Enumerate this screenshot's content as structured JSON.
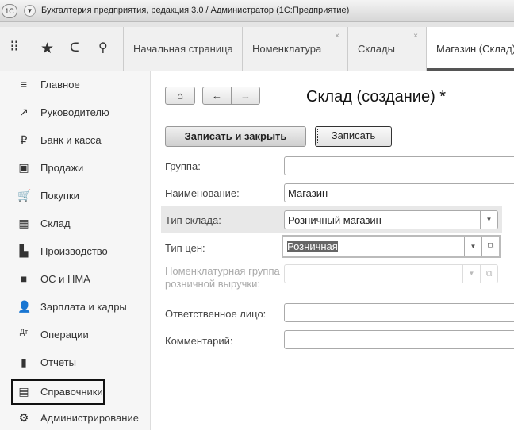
{
  "window": {
    "title": "Бухгалтерия предприятия, редакция 3.0 / Администратор  (1С:Предприятие)",
    "logo": "1С"
  },
  "toolbar_icons": [
    "apps-grid-icon",
    "star-icon",
    "history-icon",
    "search-icon"
  ],
  "tabs": [
    {
      "label": "Начальная страница"
    },
    {
      "label": "Номенклатура"
    },
    {
      "label": "Склады"
    },
    {
      "label": "Магазин (Склад)"
    }
  ],
  "sidebar": {
    "items": [
      {
        "label": "Главное",
        "icon": "≡"
      },
      {
        "label": "Руководителю",
        "icon": "↗"
      },
      {
        "label": "Банк и касса",
        "icon": "₽"
      },
      {
        "label": "Продажи",
        "icon": "▣"
      },
      {
        "label": "Покупки",
        "icon": "🛒"
      },
      {
        "label": "Склад",
        "icon": "▦"
      },
      {
        "label": "Производство",
        "icon": "▙"
      },
      {
        "label": "ОС и НМА",
        "icon": "■"
      },
      {
        "label": "Зарплата и кадры",
        "icon": "👤"
      },
      {
        "label": "Операции",
        "icon": "Дт"
      },
      {
        "label": "Отчеты",
        "icon": "▮"
      },
      {
        "label": "Справочники",
        "icon": "▤"
      },
      {
        "label": "Администрирование",
        "icon": "⚙"
      }
    ]
  },
  "form": {
    "title": "Склад (создание) *",
    "save_close": "Записать и закрыть",
    "save": "Записать",
    "fields": {
      "group": {
        "label": "Группа:",
        "value": ""
      },
      "name": {
        "label": "Наименование:",
        "value": "Магазин"
      },
      "warehouse_type": {
        "label": "Тип склада:",
        "value": "Розничный магазин"
      },
      "price_type": {
        "label": "Тип цен:",
        "value": "Розничная"
      },
      "nom_group": {
        "label": "Номенклатурная группа розничной выручки:",
        "value": ""
      },
      "responsible": {
        "label": "Ответственное лицо:",
        "value": ""
      },
      "comment": {
        "label": "Комментарий:",
        "value": ""
      }
    }
  }
}
